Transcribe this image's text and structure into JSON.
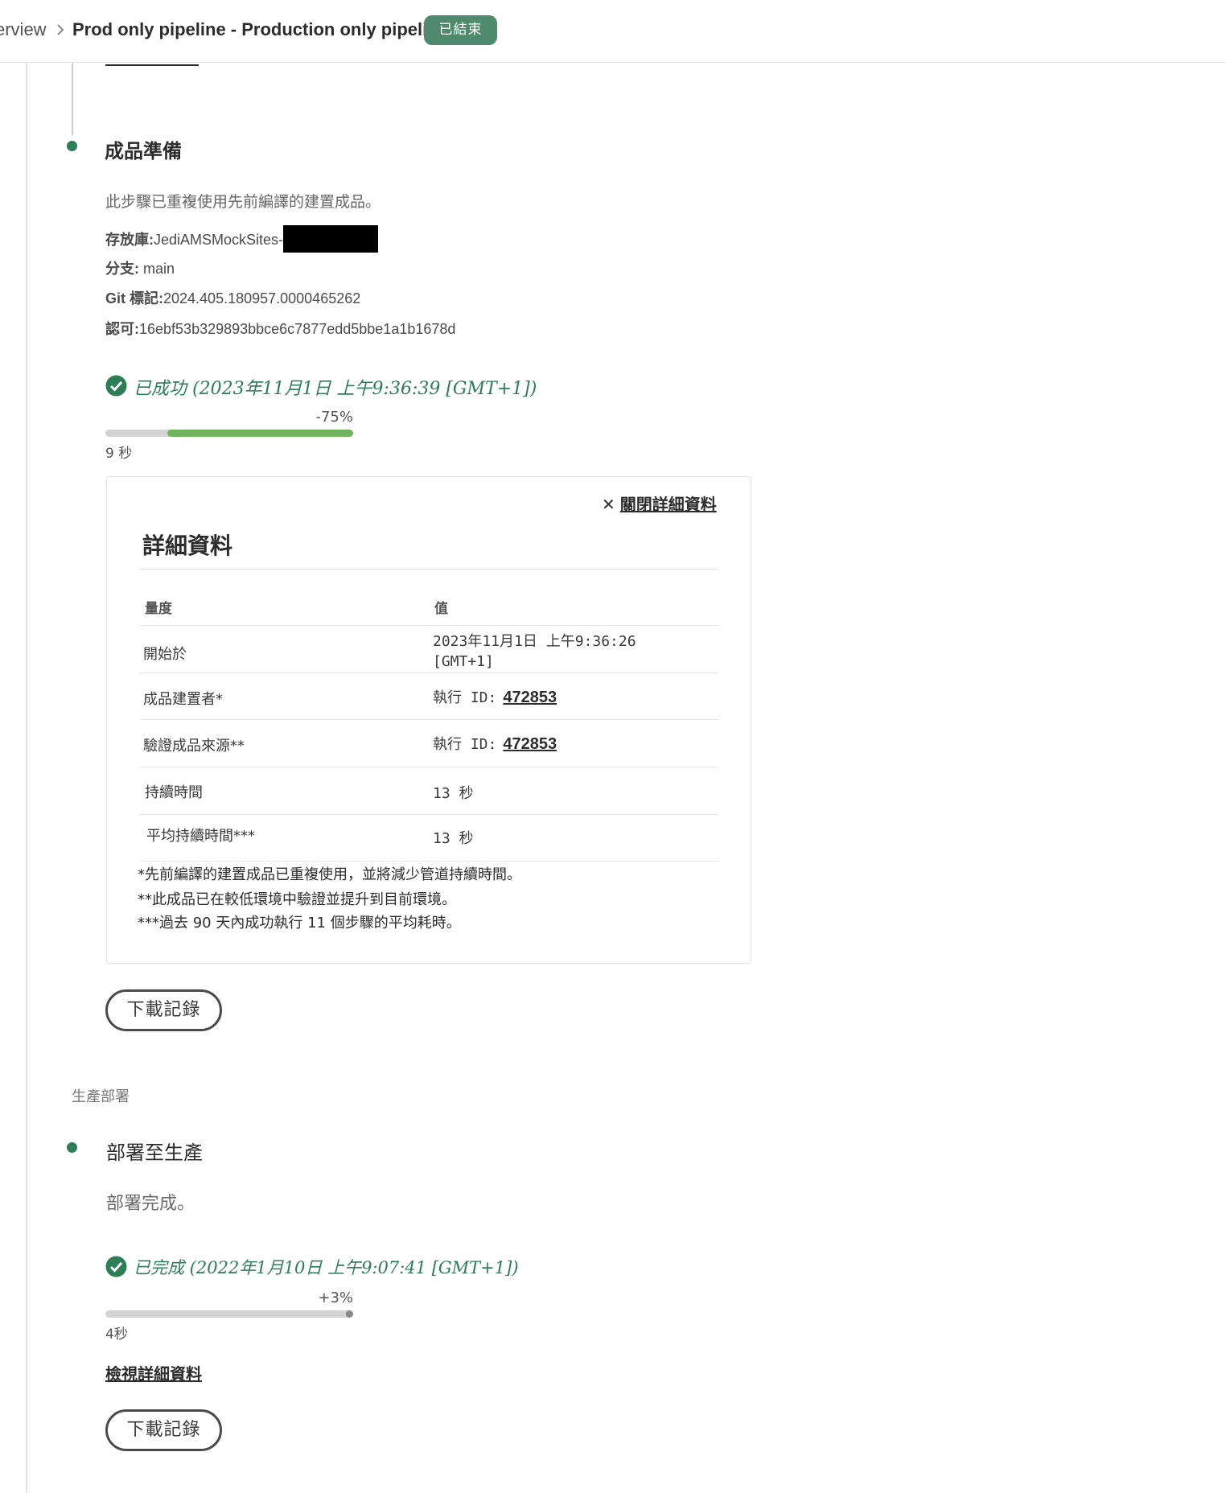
{
  "header": {
    "breadcrumb_overview": "erview",
    "title": "Prod only pipeline - Production only pipeline",
    "status_badge": "已結束"
  },
  "steps": [
    {
      "title": "成品準備",
      "description": "此步驟已重複使用先前編譯的建置成品。",
      "meta": {
        "repo_label": "存放庫:",
        "repo_value": "JediAMSMockSites-",
        "branch_label": "分支:",
        "branch_value": "main",
        "gittag_label": "Git 標記:",
        "gittag_value": "2024.405.180957.0000465262",
        "commit_label": "認可:",
        "commit_value": "16ebf53b329893bbce6c7877edd5bbe1a1b1678d"
      },
      "status_text": "已成功 (2023年11月1日 上午9:36:39 [GMT+1])",
      "delta_percent": "-75%",
      "progress": 0.75,
      "duration": "9 秒",
      "download_label": "下載記錄"
    },
    {
      "section_label": "生產部署",
      "title": "部署至生產",
      "description": "部署完成。",
      "status_text": "已完成 (2022年1月10日 上午9:07:41 [GMT+1])",
      "delta_percent": "+3%",
      "progress": 1.0,
      "duration": "4秒",
      "view_details_label": "檢視詳細資料",
      "download_label": "下載記錄"
    }
  ],
  "details": {
    "close_label": "關閉詳細資料",
    "title": "詳細資料",
    "col_metric": "量度",
    "col_value": "值",
    "rows": [
      {
        "key": "開始於",
        "value_line1": "2023年11月1日 上午9:36:26",
        "value_line2": "[GMT+1]"
      },
      {
        "key": "成品建置者*",
        "value_prefix": "執行 ID:",
        "value_link": "472853"
      },
      {
        "key": "驗證成品來源**",
        "value_prefix": "執行 ID:",
        "value_link": "472853"
      },
      {
        "key": "持續時間",
        "value": "13 秒"
      },
      {
        "key": "平均持續時間***",
        "value": "13 秒"
      }
    ],
    "notes": [
      "*先前編譯的建置成品已重複使用，並將減少管道持續時間。",
      "**此成品已在較低環境中驗證並提升到目前環境。",
      "***過去 90 天內成功執行 11 個步驟的平均耗時。"
    ]
  },
  "colors": {
    "accent_green": "#2d7d58",
    "badge_green": "#4f8a6c",
    "bar_green": "#6fb35d",
    "bar_gray": "#8a8a8a"
  }
}
